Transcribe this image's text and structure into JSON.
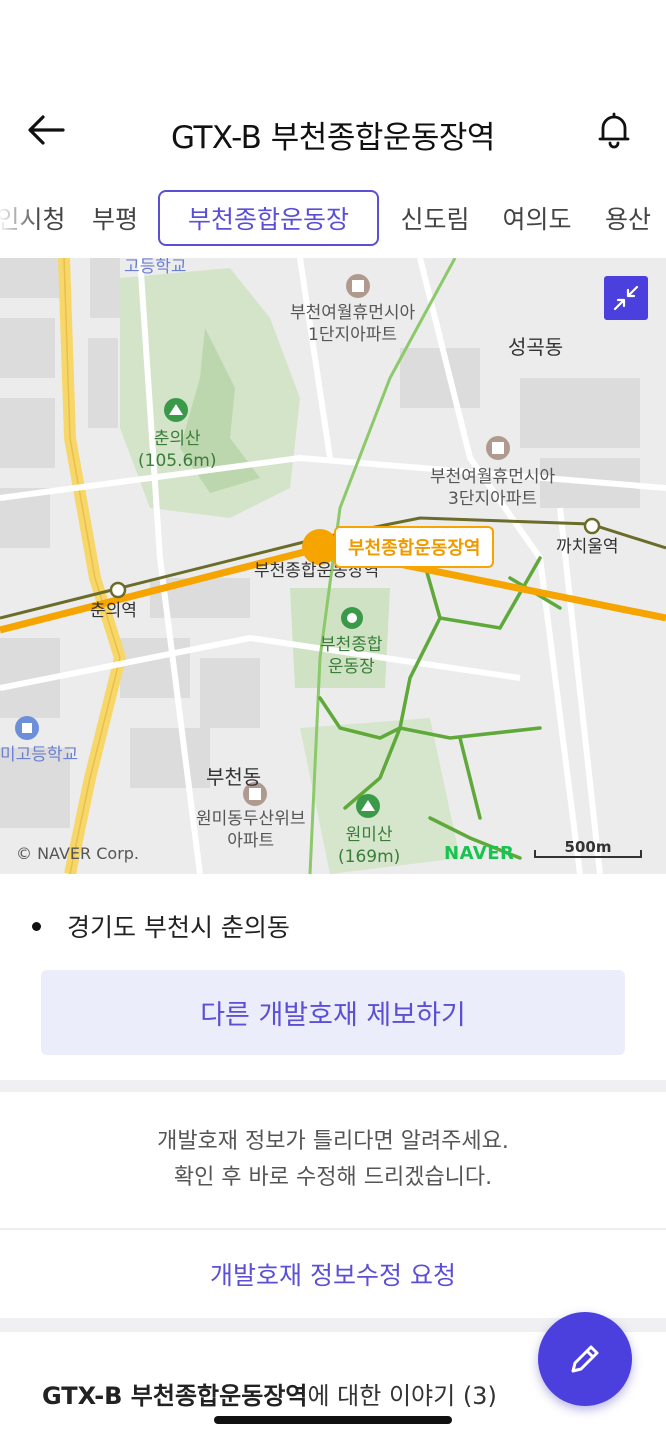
{
  "header": {
    "title": "GTX-B 부천종합운동장역",
    "back_icon": "arrow-left-icon",
    "bell_icon": "bell-icon"
  },
  "tabs": [
    {
      "label": "인시청",
      "active": false
    },
    {
      "label": "부평",
      "active": false
    },
    {
      "label": "부천종합운동장",
      "active": true
    },
    {
      "label": "신도림",
      "active": false
    },
    {
      "label": "여의도",
      "active": false
    },
    {
      "label": "용산",
      "active": false
    }
  ],
  "map": {
    "labels": {
      "school_top": "고등학교",
      "apt1": "부천여월휴먼시아\n1단지아파트",
      "seonggok": "성곡동",
      "chuneuisan": "춘의산\n(105.6m)",
      "apt3": "부천여월휴먼시아\n3단지아파트",
      "kkachiul": "까치울역",
      "chunui_station": "춘의역",
      "stadium_area": "부천종합운동장역",
      "stadium": "부천종합\n운동장",
      "school_left": "미고등학교",
      "bucheon_dong": "부천동",
      "wonmi_apt": "원미동두산위브\n아파트",
      "wonmisan": "원미산\n(169m)"
    },
    "station_label": "부천종합운동장역",
    "copyright": "© NAVER Corp.",
    "naver_logo": "NAVER",
    "scale": "500m",
    "collapse_icon": "collapse-arrows-icon",
    "colors": {
      "gtx_line": "#f5a400",
      "park": "#d3e4c9",
      "trail": "#5fa83a",
      "road_major": "#f7d76a",
      "rail": "#6b6b2a"
    }
  },
  "address": "경기도 부천시 춘의동",
  "report_button": "다른 개발호재 제보하기",
  "notice": {
    "line1": "개발호재 정보가 틀리다면 알려주세요.",
    "line2": "확인 후 바로 수정해 드리겠습니다."
  },
  "edit_request": "개발호재 정보수정 요청",
  "story": {
    "bold": "GTX-B 부천종합운동장역",
    "rest": "에 대한 이야기 (3)"
  },
  "fab_icon": "pencil-icon"
}
